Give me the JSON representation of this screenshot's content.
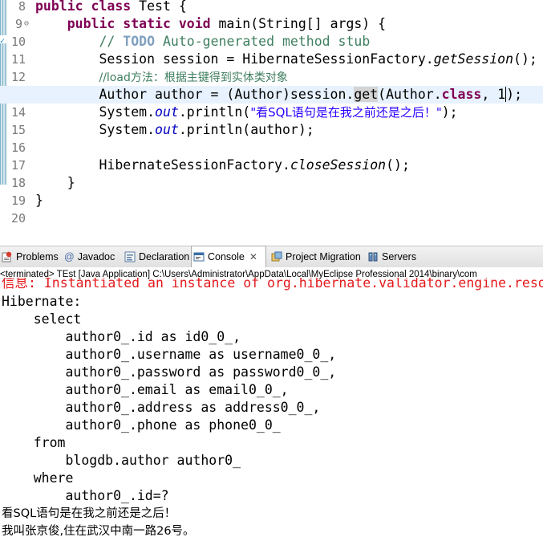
{
  "editor": {
    "line_numbers": [
      "8",
      "9",
      "10",
      "11",
      "12",
      "13",
      "14",
      "15",
      "16",
      "17",
      "18",
      "19",
      "20"
    ],
    "fold_symbol": "⊖",
    "task_marker": "✓",
    "lines": {
      "l8": {
        "a": "public class",
        "b": " Test {"
      },
      "l9": {
        "a": "    ",
        "b": "public static void",
        "c": " main(String[] args) {"
      },
      "l10": {
        "a": "        ",
        "b": "// ",
        "c": "TODO",
        "d": " Auto-generated method stub"
      },
      "l11": {
        "a": "        Session session = HibernateSessionFactory.",
        "b": "getSession",
        "c": "();"
      },
      "l12": {
        "a": "        ",
        "b": "//load方法：根据主键得到实体类对象"
      },
      "l13": {
        "a": "        Author author = (Author)session.",
        "b": "get",
        "c": "(Author.",
        "d": "class",
        "e": ", 1",
        "f": ");"
      },
      "l14": {
        "a": "        System.",
        "b": "out",
        "c": ".println(",
        "d": "\"看SQL语句是在我之前还是之后！\"",
        "e": ");"
      },
      "l15": {
        "a": "        System.",
        "b": "out",
        "c": ".println(author);"
      },
      "l16": {
        "a": ""
      },
      "l17": {
        "a": "        HibernateSessionFactory.",
        "b": "closeSession",
        "c": "();"
      },
      "l18": {
        "a": "    }"
      },
      "l19": {
        "a": "}"
      },
      "l20": {
        "a": ""
      }
    }
  },
  "tabs": [
    {
      "label": "Problems",
      "icon": "problems-icon"
    },
    {
      "label": "Javadoc",
      "icon": "at-icon",
      "glyph": "@"
    },
    {
      "label": "Declaration",
      "icon": "declaration-icon"
    },
    {
      "label": "Console",
      "icon": "console-icon",
      "close": "✕"
    },
    {
      "label": "Project Migration",
      "icon": "migration-icon"
    },
    {
      "label": "Servers",
      "icon": "servers-icon"
    }
  ],
  "console": {
    "header": "<terminated> TEst [Java Application] C:\\Users\\Administrator\\AppData\\Local\\MyEclipse Professional 2014\\binary\\com",
    "lines": [
      "信息: Instantiated an instance of org.hibernate.validator.engine.reso",
      "Hibernate: ",
      "    select",
      "        author0_.id as id0_0_,",
      "        author0_.username as username0_0_,",
      "        author0_.password as password0_0_,",
      "        author0_.email as email0_0_,",
      "        author0_.address as address0_0_,",
      "        author0_.phone as phone0_0_ ",
      "    from",
      "        blogdb.author author0_ ",
      "    where",
      "        author0_.id=?",
      "看SQL语句是在我之前还是之后！",
      "我叫张京俊,住在武汉中南一路26号。"
    ]
  },
  "colors": {
    "keyword": "#7f0055",
    "comment": "#3f7f5f",
    "string": "#2a00ff",
    "field": "#0000c0",
    "current_line": "#e8f2fe",
    "error": "#e31a1c"
  }
}
